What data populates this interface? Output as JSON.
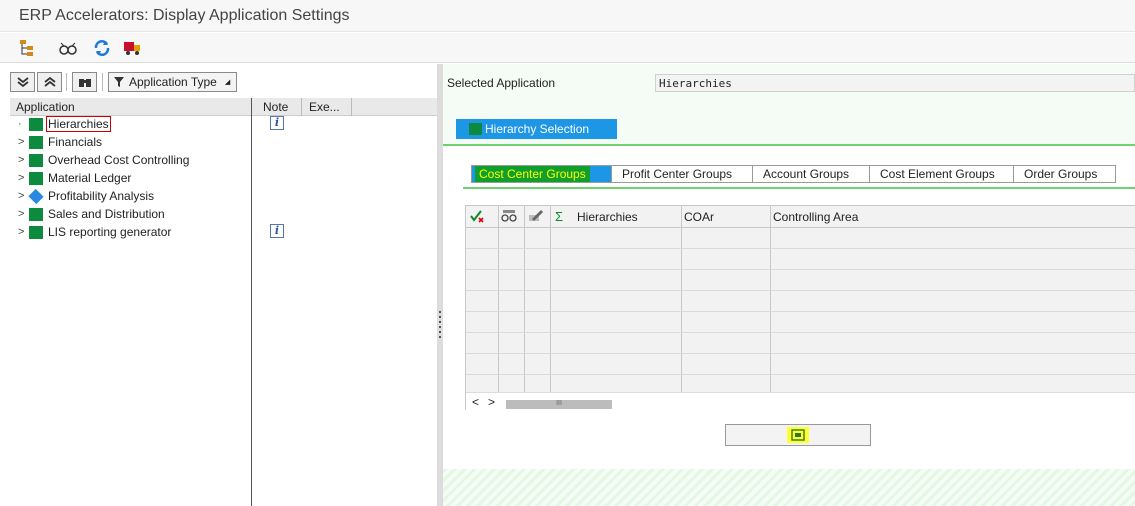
{
  "window": {
    "title": "ERP Accelerators: Display Application Settings"
  },
  "toolbar": {
    "icons": [
      "hierarchy-tree-icon",
      "glasses-icon",
      "refresh-icon",
      "transport-truck-icon"
    ]
  },
  "left": {
    "app_type_label": "Application Type",
    "columns": [
      "Application",
      "Note",
      "Exe..."
    ],
    "items": [
      {
        "label": "Hierarchies",
        "expander": "·",
        "icon": "green-square-icon",
        "note": "i",
        "selected": true
      },
      {
        "label": "Financials",
        "expander": ">",
        "icon": "green-square-icon",
        "note": ""
      },
      {
        "label": "Overhead Cost Controlling",
        "expander": ">",
        "icon": "green-square-icon",
        "note": ""
      },
      {
        "label": "Material Ledger",
        "expander": ">",
        "icon": "green-square-icon",
        "note": ""
      },
      {
        "label": "Profitability Analysis",
        "expander": ">",
        "icon": "blue-diamond-icon",
        "note": ""
      },
      {
        "label": "Sales and Distribution",
        "expander": ">",
        "icon": "green-square-icon",
        "note": ""
      },
      {
        "label": "LIS reporting generator",
        "expander": ">",
        "icon": "green-square-icon",
        "note": "i"
      }
    ]
  },
  "right": {
    "selected_label": "Selected Application",
    "selected_value": "Hierarchies",
    "main_tab": "Hierarchy Selection",
    "sub_tabs": [
      "Cost Center Groups",
      "Profit Center Groups",
      "Account Groups",
      "Cost Element Groups",
      "Order Groups"
    ],
    "grid": {
      "sum_symbol": "Σ",
      "columns": [
        "Hierarchies",
        "COAr",
        "Controlling Area"
      ],
      "scroll_left": "<",
      "scroll_right": ">",
      "thumb": "III"
    }
  },
  "colors": {
    "accent_blue": "#1e96e6",
    "green": "#0c8a3e",
    "highlight_yellow": "#ffff33"
  }
}
